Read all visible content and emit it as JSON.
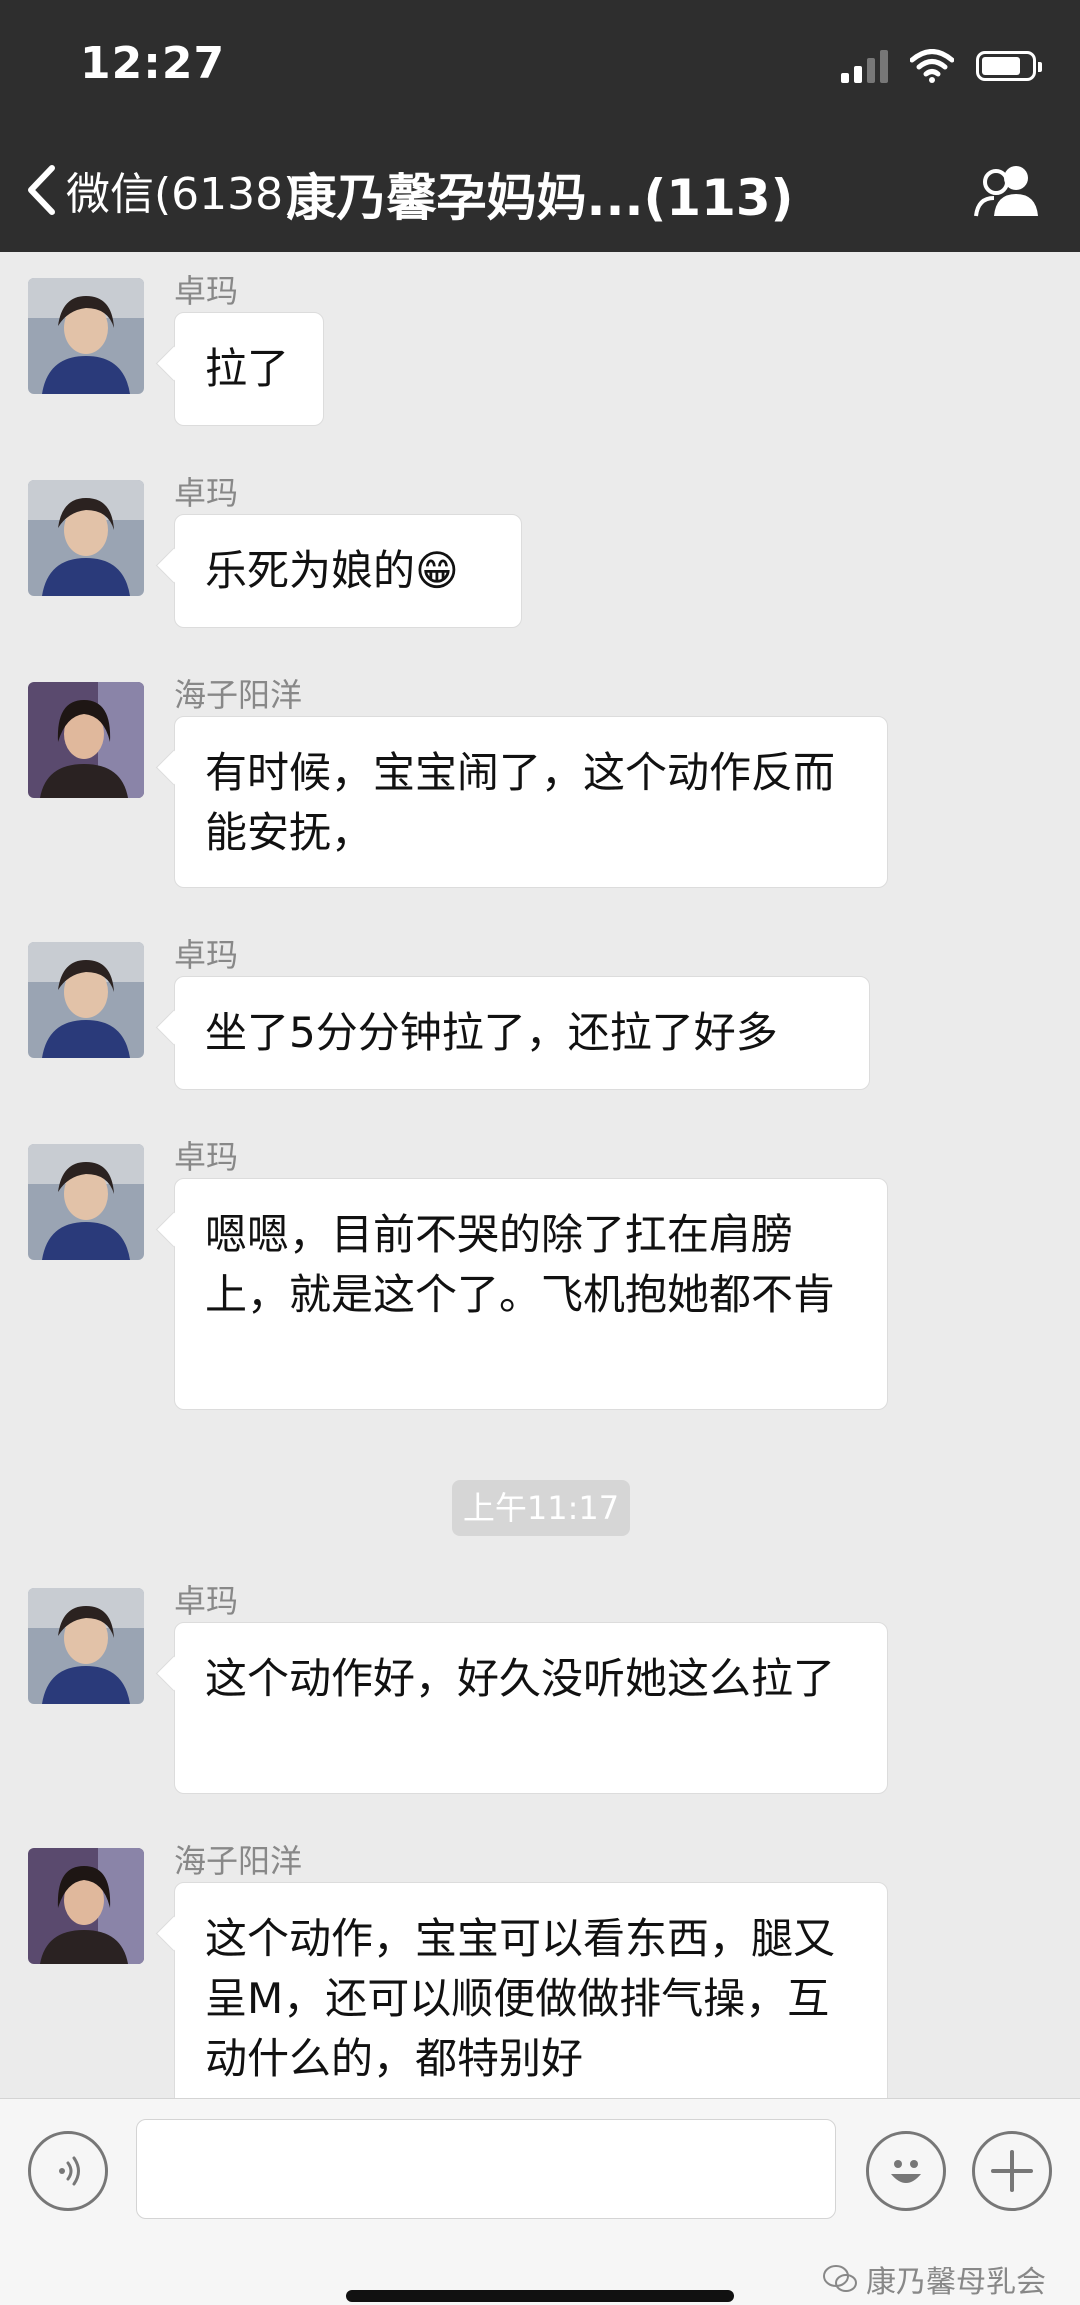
{
  "status_bar": {
    "time": "12:27"
  },
  "nav": {
    "back_label": "微信(6138)",
    "title": "康乃馨孕妈妈...(113)"
  },
  "messages": [
    {
      "sender": "卓玛",
      "text": "拉了"
    },
    {
      "sender": "卓玛",
      "text": "乐死为娘的😁"
    },
    {
      "sender": "海子阳洋",
      "text": "有时候，宝宝闹了，这个动作反而能安抚，"
    },
    {
      "sender": "卓玛",
      "text": "坐了5分分钟拉了，还拉了好多"
    },
    {
      "sender": "卓玛",
      "text": "嗯嗯，目前不哭的除了扛在肩膀上，就是这个了。飞机抱她都不肯"
    },
    {
      "sender": "卓玛",
      "text": "这个动作好，好久没听她这么拉了"
    },
    {
      "sender": "海子阳洋",
      "text": "这个动作，宝宝可以看东西，腿又呈M，还可以顺便做做排气操，互动什么的，都特别好"
    }
  ],
  "timestamp": "上午11:17",
  "input": {
    "value": "",
    "placeholder": ""
  },
  "watermark": "康乃馨母乳会",
  "colors": {
    "nav_background": "#2e2e2e",
    "chat_background": "#ebebeb",
    "bubble_background": "#ffffff",
    "sender_text": "#888888"
  }
}
